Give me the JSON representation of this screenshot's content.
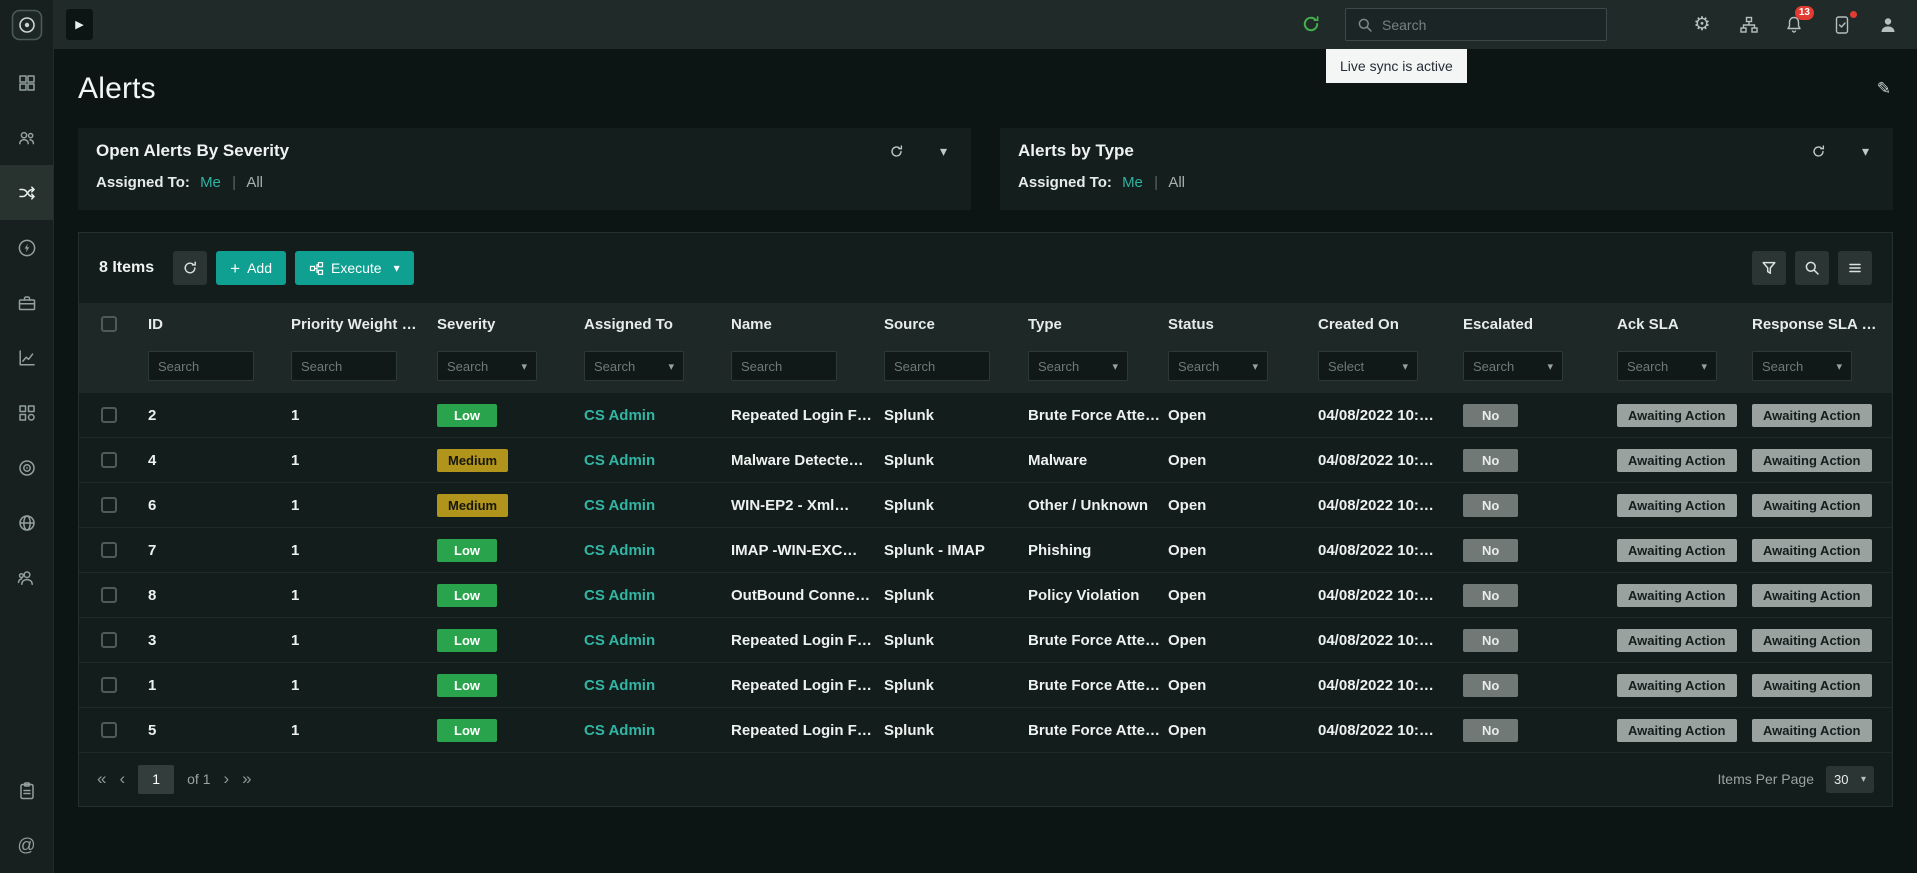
{
  "topbar": {
    "search_placeholder": "Search",
    "bell_badge": "13",
    "tooltip": "Live sync is active"
  },
  "page": {
    "title": "Alerts"
  },
  "widgets": [
    {
      "title": "Open Alerts By Severity",
      "assigned_to_label": "Assigned To:",
      "me": "Me",
      "separator": "|",
      "all": "All"
    },
    {
      "title": "Alerts by Type",
      "assigned_to_label": "Assigned To:",
      "me": "Me",
      "separator": "|",
      "all": "All"
    }
  ],
  "table": {
    "items_label": "8 Items",
    "add_label": "Add",
    "execute_label": "Execute",
    "columns": [
      {
        "label": "ID",
        "filter": "input",
        "placeholder": "Search"
      },
      {
        "label": "Priority Weight …",
        "filter": "input",
        "placeholder": "Search"
      },
      {
        "label": "Severity",
        "filter": "select",
        "placeholder": "Search"
      },
      {
        "label": "Assigned To",
        "filter": "select",
        "placeholder": "Search"
      },
      {
        "label": "Name",
        "filter": "input",
        "placeholder": "Search"
      },
      {
        "label": "Source",
        "filter": "input",
        "placeholder": "Search"
      },
      {
        "label": "Type",
        "filter": "select",
        "placeholder": "Search"
      },
      {
        "label": "Status",
        "filter": "select",
        "placeholder": "Search"
      },
      {
        "label": "Created On",
        "filter": "select",
        "placeholder": "Select"
      },
      {
        "label": "Escalated",
        "filter": "select",
        "placeholder": "Search"
      },
      {
        "label": "Ack SLA",
        "filter": "select",
        "placeholder": "Search"
      },
      {
        "label": "Response SLA …",
        "filter": "select",
        "placeholder": "Search"
      }
    ],
    "rows": [
      {
        "id": "2",
        "priority_weight": "1",
        "severity": "Low",
        "assigned_to": "CS Admin",
        "name": "Repeated Login F…",
        "source": "Splunk",
        "type": "Brute Force Atte…",
        "status": "Open",
        "created_on": "04/08/2022 10:…",
        "escalated": "No",
        "ack_sla": "Awaiting Action",
        "response_sla": "Awaiting Action"
      },
      {
        "id": "4",
        "priority_weight": "1",
        "severity": "Medium",
        "assigned_to": "CS Admin",
        "name": "Malware Detecte…",
        "source": "Splunk",
        "type": "Malware",
        "status": "Open",
        "created_on": "04/08/2022 10:…",
        "escalated": "No",
        "ack_sla": "Awaiting Action",
        "response_sla": "Awaiting Action"
      },
      {
        "id": "6",
        "priority_weight": "1",
        "severity": "Medium",
        "assigned_to": "CS Admin",
        "name": "WIN-EP2 - Xml…",
        "source": "Splunk",
        "type": "Other / Unknown",
        "status": "Open",
        "created_on": "04/08/2022 10:…",
        "escalated": "No",
        "ack_sla": "Awaiting Action",
        "response_sla": "Awaiting Action"
      },
      {
        "id": "7",
        "priority_weight": "1",
        "severity": "Low",
        "assigned_to": "CS Admin",
        "name": "IMAP -WIN-EXC…",
        "source": "Splunk - IMAP",
        "type": "Phishing",
        "status": "Open",
        "created_on": "04/08/2022 10:…",
        "escalated": "No",
        "ack_sla": "Awaiting Action",
        "response_sla": "Awaiting Action"
      },
      {
        "id": "8",
        "priority_weight": "1",
        "severity": "Low",
        "assigned_to": "CS Admin",
        "name": "OutBound Conne…",
        "source": "Splunk",
        "type": "Policy Violation",
        "status": "Open",
        "created_on": "04/08/2022 10:…",
        "escalated": "No",
        "ack_sla": "Awaiting Action",
        "response_sla": "Awaiting Action"
      },
      {
        "id": "3",
        "priority_weight": "1",
        "severity": "Low",
        "assigned_to": "CS Admin",
        "name": "Repeated Login F…",
        "source": "Splunk",
        "type": "Brute Force Atte…",
        "status": "Open",
        "created_on": "04/08/2022 10:…",
        "escalated": "No",
        "ack_sla": "Awaiting Action",
        "response_sla": "Awaiting Action"
      },
      {
        "id": "1",
        "priority_weight": "1",
        "severity": "Low",
        "assigned_to": "CS Admin",
        "name": "Repeated Login F…",
        "source": "Splunk",
        "type": "Brute Force Atte…",
        "status": "Open",
        "created_on": "04/08/2022 10:…",
        "escalated": "No",
        "ack_sla": "Awaiting Action",
        "response_sla": "Awaiting Action"
      },
      {
        "id": "5",
        "priority_weight": "1",
        "severity": "Low",
        "assigned_to": "CS Admin",
        "name": "Repeated Login F…",
        "source": "Splunk",
        "type": "Brute Force Atte…",
        "status": "Open",
        "created_on": "04/08/2022 10:…",
        "escalated": "No",
        "ack_sla": "Awaiting Action",
        "response_sla": "Awaiting Action"
      }
    ],
    "pagination": {
      "page": "1",
      "of": "of 1",
      "items_per_page_label": "Items Per Page",
      "items_per_page": "30"
    }
  },
  "glyphs": {
    "caret_down": "▾",
    "plus": "+",
    "play": "▶",
    "gear": "⚙",
    "edit": "✎",
    "first": "«",
    "prev": "‹",
    "next": "›",
    "last": "»",
    "mention": "@"
  },
  "sidebar_icon_names": [
    "dashboard-icon",
    "teams-icon",
    "shuffle-alerts-icon",
    "bolt-icon",
    "briefcase-icon",
    "analytics-icon",
    "apps-icon",
    "target-icon",
    "globe-icon",
    "user-group-icon",
    "clipboard-icon",
    "mention-icon"
  ],
  "colors": {
    "accent_teal": "#0fa091",
    "severity_low": "#2aa44c",
    "severity_medium": "#b0941c",
    "link_teal": "#33b5a4",
    "badge_no_gray": "#717977",
    "badge_sla_gray": "#9aa2a0",
    "notification_red": "#e23b31",
    "sync_green": "#43b14b"
  }
}
